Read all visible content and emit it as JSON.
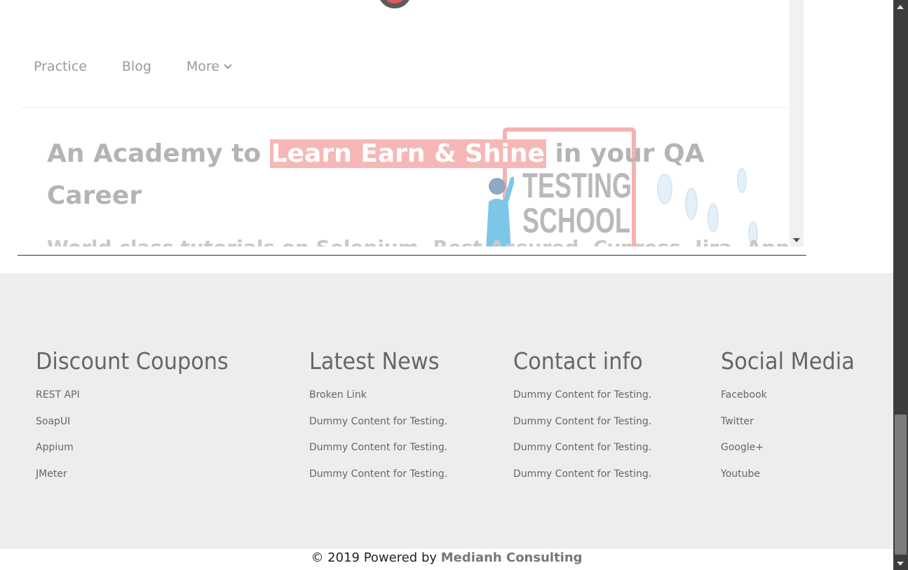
{
  "iframe": {
    "nav": {
      "practice": "Practice",
      "blog": "Blog",
      "more": "More"
    },
    "hero": {
      "title_pre": "An Academy to ",
      "title_highlight": "Learn Earn & Shine",
      "title_post": "  in your QA Career",
      "subtitle": "World class tutorials on Selenium, Rest Assured, Cypress, Jira, Appium, Cucumber",
      "art_text_1": "TESTING",
      "art_text_2": "SCHOOL"
    }
  },
  "footer": {
    "columns": [
      {
        "title": "Discount Coupons",
        "items": [
          "REST API",
          "SoapUI",
          "Appium",
          "JMeter"
        ]
      },
      {
        "title": "Latest News",
        "items": [
          "Broken Link",
          "Dummy Content for Testing.",
          "Dummy Content for Testing.",
          "Dummy Content for Testing."
        ]
      },
      {
        "title": "Contact info",
        "items": [
          "Dummy Content for Testing.",
          "Dummy Content for Testing.",
          "Dummy Content for Testing.",
          "Dummy Content for Testing."
        ]
      },
      {
        "title": "Social Media",
        "items": [
          "Facebook",
          "Twitter",
          "Google+",
          "Youtube"
        ]
      }
    ]
  },
  "copyright": {
    "prefix": "© 2019 Powered by ",
    "link": "Medianh Consulting"
  },
  "colors": {
    "footer_bg": "#ededed",
    "highlight": "#f6b7b7",
    "scrollbar": "#3c3c3c"
  }
}
